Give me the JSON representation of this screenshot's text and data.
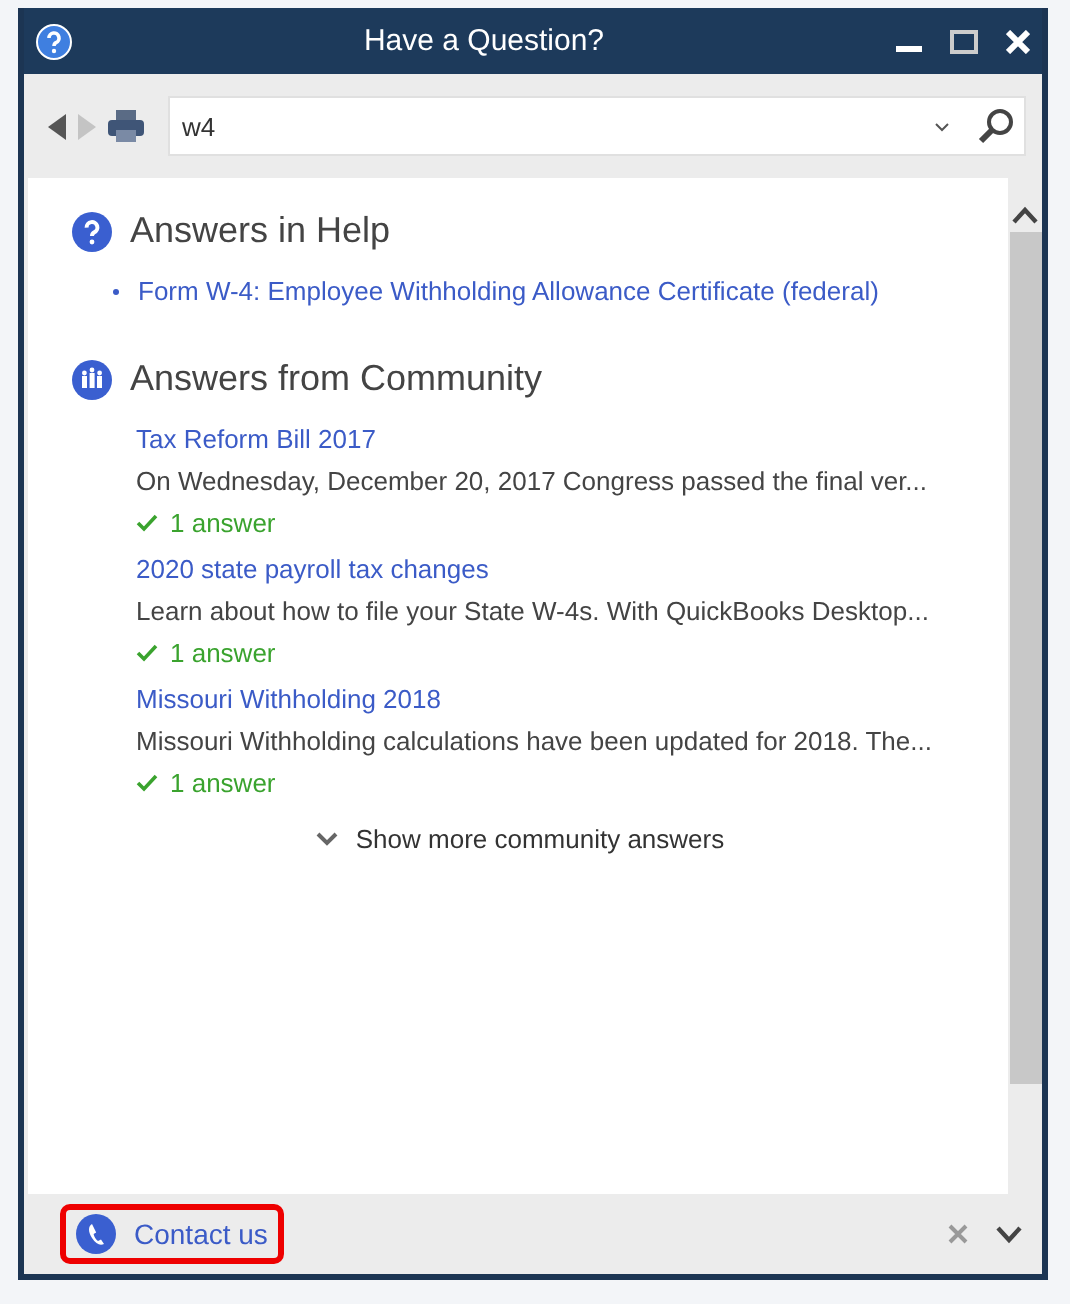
{
  "window": {
    "title": "Have a Question?"
  },
  "search": {
    "value": "w4"
  },
  "help": {
    "heading": "Answers in Help",
    "links": [
      "Form W-4: Employee Withholding Allowance Certificate (federal)"
    ]
  },
  "community": {
    "heading": "Answers from Community",
    "posts": [
      {
        "title": "Tax Reform Bill 2017",
        "excerpt": "On Wednesday, December 20, 2017 Congress passed the final ver...",
        "answers": "1 answer"
      },
      {
        "title": "2020 state payroll tax changes",
        "excerpt": "Learn about how to file your State W-4s. With QuickBooks Desktop...",
        "answers": "1 answer"
      },
      {
        "title": "Missouri Withholding 2018",
        "excerpt": "Missouri Withholding calculations have been updated for 2018. The...",
        "answers": "1 answer"
      }
    ],
    "more": "Show more community answers"
  },
  "footer": {
    "contact": "Contact us",
    "highlighted": true
  }
}
